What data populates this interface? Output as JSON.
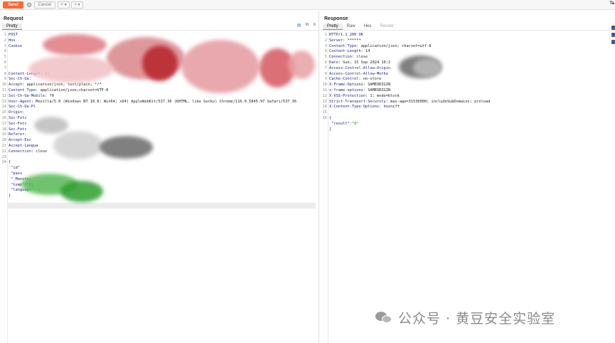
{
  "toolbar": {
    "send_label": "Send",
    "cancel_label": "Cancel",
    "back_label": "< ▾",
    "forward_label": "> ▾",
    "target_label": "Ta"
  },
  "request": {
    "title": "Request",
    "tabs": [
      {
        "label": "Pretty"
      }
    ],
    "lines": [
      {
        "n": "1",
        "key": "POST",
        "val": ""
      },
      {
        "n": "2",
        "key": "Hos",
        "val": ""
      },
      {
        "n": "3",
        "key": "Cookie",
        "val": ""
      },
      {
        "n": "4",
        "key": "",
        "val": ""
      },
      {
        "n": "5",
        "key": "",
        "val": ""
      },
      {
        "n": "6",
        "key": "",
        "val": ""
      },
      {
        "n": "7",
        "key": "",
        "val": ""
      },
      {
        "n": "8",
        "key": "Content-Length:",
        "val": " 2/"
      },
      {
        "n": "9",
        "key": "Sec-Ch-Ua:",
        "val": ""
      },
      {
        "n": "10",
        "key": "Accept:",
        "val": " application/json, text/plain, */*"
      },
      {
        "n": "11",
        "key": "Content-Type:",
        "val": " application/json;charset=UTF-8"
      },
      {
        "n": "12",
        "key": "Sec-Ch-Ua-Mobile:",
        "val": " ?0"
      },
      {
        "n": "13",
        "key": "User-Agent:",
        "val": " Mozilla/5.0 (Windows NT 10.0; Win64; x64) AppleWebKit/537.36 (KHTML, like Gecko) Chrome/116.0.5845.97 Safari/537.36"
      },
      {
        "n": "14",
        "key": "Sec-Ch-Ua-Pl",
        "val": ""
      },
      {
        "n": "15",
        "key": "Origin:",
        "val": ""
      },
      {
        "n": "16",
        "key": "Sec-Fetc",
        "val": ""
      },
      {
        "n": "17",
        "key": "Sec-Fetc",
        "val": ""
      },
      {
        "n": "18",
        "key": "Sec-Fetc",
        "val": ""
      },
      {
        "n": "19",
        "key": "Referer:",
        "val": ""
      },
      {
        "n": "20",
        "key": "Accept-Enc",
        "val": ""
      },
      {
        "n": "21",
        "key": "Accept-Langua",
        "val": ""
      },
      {
        "n": "22",
        "key": "Connection:",
        "val": " close"
      },
      {
        "n": "23",
        "key": "",
        "val": ""
      },
      {
        "n": "24",
        "key": "{",
        "val": ""
      },
      {
        "n": "",
        "key": "  \"id\"",
        "val": ""
      },
      {
        "n": "",
        "key": "  \"pass",
        "val": ""
      },
      {
        "n": "",
        "key": "  \"_Monster",
        "val": ""
      },
      {
        "n": "",
        "key": "  \"temp\"",
        "val": ":\"01"
      },
      {
        "n": "",
        "key": "  \"language\"",
        "val": ":\"c"
      },
      {
        "n": "",
        "key": "}",
        "val": ""
      }
    ]
  },
  "response": {
    "title": "Response",
    "tabs": [
      {
        "label": "Pretty"
      },
      {
        "label": "Raw"
      },
      {
        "label": "Hex"
      },
      {
        "label": "Render"
      }
    ],
    "lines": [
      {
        "n": "1",
        "key": "HTTP/1.1 200 OK",
        "val": ""
      },
      {
        "n": "2",
        "key": "Server:",
        "val": " ******"
      },
      {
        "n": "3",
        "key": "Content-Type:",
        "val": " application/json; charset=utf-8"
      },
      {
        "n": "4",
        "key": "Content-Length:",
        "val": " 14"
      },
      {
        "n": "5",
        "key": "Connection:",
        "val": " close"
      },
      {
        "n": "6",
        "key": "Date:",
        "val": " Sun, 15 Sep 2024 10:2"
      },
      {
        "n": "7",
        "key": "Access-Control-Allow-Origin",
        "val": ""
      },
      {
        "n": "8",
        "key": "Access-Control-Allow-Metho",
        "val": ""
      },
      {
        "n": "9",
        "key": "Cache-Control:",
        "val": " no-store"
      },
      {
        "n": "10",
        "key": "X-Frame-Options:",
        "val": " SAMEORIGIN"
      },
      {
        "n": "11",
        "key": "x-frame-options:",
        "val": " SAMEORIGIN"
      },
      {
        "n": "12",
        "key": "X-XSS-Protection:",
        "val": " 1; mode=block"
      },
      {
        "n": "13",
        "key": "Strict-Transport-Security:",
        "val": " max-age=31536000; includeSubDomains; preload"
      },
      {
        "n": "14",
        "key": "X-Content-Type-Options:",
        "val": " nosniff"
      },
      {
        "n": "15",
        "key": "",
        "val": ""
      },
      {
        "n": "16",
        "key": "{",
        "val": ""
      },
      {
        "n": "",
        "key": "  \"result\"",
        "val": ":\"0\""
      },
      {
        "n": "",
        "key": "}",
        "val": ""
      }
    ]
  },
  "watermark": {
    "text": "公众号 · 黄豆安全实验室"
  },
  "colors": {
    "send": "#ff6633",
    "key": "#1b1b7a",
    "string": "#0e7a0e",
    "redaction_red": "#c0303a",
    "redaction_green": "#2e9e2e",
    "redaction_gray": "#555555"
  }
}
